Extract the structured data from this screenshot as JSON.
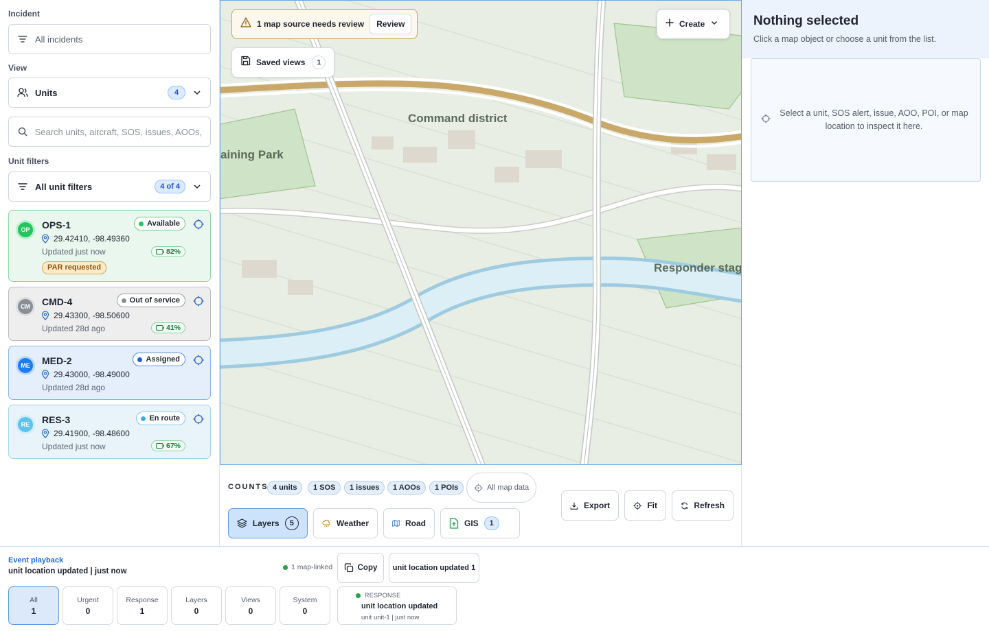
{
  "sidebar": {
    "incident_label": "Incident",
    "incident_value": "All incidents",
    "view_label": "View",
    "view_value": "Units",
    "view_count": "4",
    "search_placeholder": "Search units, aircraft, SOS, issues, AOOs, POIs",
    "unit_filters_label": "Unit filters",
    "unit_filters_value": "All unit filters",
    "unit_filters_count": "4 of 4"
  },
  "units": [
    {
      "initials": "OP",
      "name": "OPS-1",
      "status": "Available",
      "coords": "29.42410, -98.49360",
      "updated": "Updated just now",
      "battery": "82%",
      "tag": "PAR requested",
      "avatar_color": "#22c55e",
      "status_dot": "#22c55e"
    },
    {
      "initials": "CM",
      "name": "CMD-4",
      "status": "Out of service",
      "coords": "29.43300, -98.50600",
      "updated": "Updated 28d ago",
      "battery": "41%",
      "tag": "",
      "avatar_color": "#8a8f96",
      "status_dot": "#8a8f96"
    },
    {
      "initials": "ME",
      "name": "MED-2",
      "status": "Assigned",
      "coords": "29.43000, -98.49000",
      "updated": "Updated 28d ago",
      "battery": "",
      "tag": "",
      "avatar_color": "#1d7df0",
      "status_dot": "#1d5fd8"
    },
    {
      "initials": "RE",
      "name": "RES-3",
      "status": "En route",
      "coords": "29.41900, -98.48600",
      "updated": "Updated just now",
      "battery": "67%",
      "tag": "",
      "avatar_color": "#5ec2ef",
      "status_dot": "#38aee8"
    }
  ],
  "map": {
    "alert_text": "1 map source needs review",
    "review_label": "Review",
    "saved_views_label": "Saved views",
    "saved_views_count": "1",
    "create_label": "Create",
    "labels": {
      "command": "Command district",
      "park": "aining Park",
      "staging": "Responder stag"
    }
  },
  "counts": {
    "label": "COUNTS",
    "items": [
      "4 units",
      "1 SOS",
      "1 issues",
      "1 AOOs",
      "1 POIs"
    ],
    "all_map_data": "All map data"
  },
  "toolbar": {
    "layers": "Layers",
    "layers_count": "5",
    "weather": "Weather",
    "road": "Road",
    "gis": "GIS",
    "gis_count": "1",
    "export": "Export",
    "fit": "Fit",
    "refresh": "Refresh"
  },
  "inspector": {
    "title": "Nothing selected",
    "subtitle": "Click a map object or choose a unit from the list.",
    "empty_text": "Select a unit, SOS alert, issue, AOO, POI, or map location to inspect it here."
  },
  "events": {
    "title": "Event playback",
    "summary": "unit location updated | just now",
    "map_linked": "1 map-linked",
    "copy": "Copy",
    "latest": "unit location updated 1",
    "filters": [
      {
        "label": "All",
        "value": "1"
      },
      {
        "label": "Urgent",
        "value": "0"
      },
      {
        "label": "Response",
        "value": "1"
      },
      {
        "label": "Layers",
        "value": "0"
      },
      {
        "label": "Views",
        "value": "0"
      },
      {
        "label": "System",
        "value": "0"
      }
    ],
    "card": {
      "kind": "RESPONSE",
      "title": "unit location updated",
      "meta": "unit unit-1 | just now"
    }
  }
}
